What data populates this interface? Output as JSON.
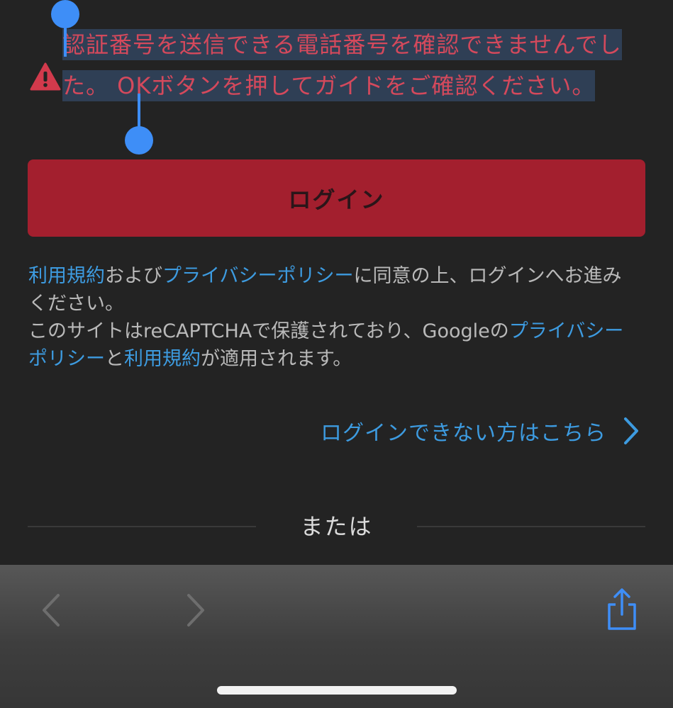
{
  "error": {
    "message": "認証番号を送信できる電話番号を確認できませんでした。 OKボタンを押してガイドをご確認ください。",
    "icon": "warning-icon",
    "color": "#d4495c"
  },
  "login": {
    "button_label": "ログイン",
    "color": "#a31f2e"
  },
  "terms": {
    "line1": {
      "link_terms": "利用規約",
      "text_and": "および",
      "link_privacy": "プライバシーポリシー",
      "text_rest": "に同意の上、ログインへお進みください。"
    },
    "line2": {
      "text_start": "このサイトはreCAPTCHAで保護されており、Googleの",
      "link_privacy": "プライバシーポリシー",
      "text_and": "と",
      "link_terms": "利用規約",
      "text_end": "が適用されます。"
    },
    "link_color": "#3d9be0"
  },
  "help": {
    "link_label": "ログインできない方はこちら",
    "icon": "chevron-right-icon"
  },
  "divider": {
    "label": "または"
  },
  "toolbar": {
    "back_icon": "chevron-left-icon",
    "forward_icon": "chevron-right-icon",
    "share_icon": "share-icon"
  }
}
